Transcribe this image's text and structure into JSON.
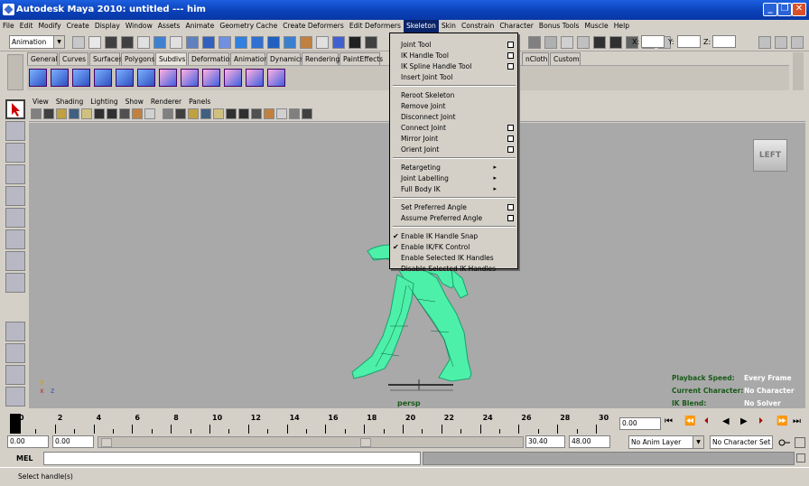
{
  "window": {
    "title": "Autodesk Maya 2010: untitled   ---   him"
  },
  "menubar": [
    "File",
    "Edit",
    "Modify",
    "Create",
    "Display",
    "Window",
    "Assets",
    "Animate",
    "Geometry Cache",
    "Create Deformers",
    "Edit Deformers",
    "Skeleton",
    "Skin",
    "Constrain",
    "Character",
    "Bonus Tools",
    "Muscle",
    "Help"
  ],
  "menubar_active": "Skeleton",
  "statusline": {
    "mode": "Animation",
    "x_label": "X:",
    "y_label": "Y:",
    "z_label": "Z:"
  },
  "shelf_tabs": [
    "General",
    "Curves",
    "Surfaces",
    "Polygons",
    "Subdivs",
    "Deformation",
    "Animation",
    "Dynamics",
    "Rendering",
    "PaintEffects",
    "nCloth",
    "Custom"
  ],
  "shelf_active": "Subdivs",
  "panel_menu": [
    "View",
    "Shading",
    "Lighting",
    "Show",
    "Renderer",
    "Panels"
  ],
  "viewport": {
    "camera_label": "persp",
    "view_cube_label": "LEFT",
    "axis_x": "x",
    "axis_z": "z",
    "axis_y": "y"
  },
  "hud": {
    "playback_label": "Playback Speed:",
    "playback_value": "Every Frame",
    "character_label": "Current Character:",
    "character_value": "No Character",
    "ikblend_label": "IK Blend:",
    "ikblend_value": "No Solver"
  },
  "skeleton_menu": {
    "group1": [
      {
        "label": "Joint Tool",
        "option": true
      },
      {
        "label": "IK Handle Tool",
        "option": true
      },
      {
        "label": "IK Spline Handle Tool",
        "option": true
      },
      {
        "label": "Insert Joint Tool",
        "option": false
      }
    ],
    "group2": [
      {
        "label": "Reroot Skeleton",
        "option": false
      },
      {
        "label": "Remove Joint",
        "option": false
      },
      {
        "label": "Disconnect Joint",
        "option": false
      },
      {
        "label": "Connect Joint",
        "option": true
      },
      {
        "label": "Mirror Joint",
        "option": true
      },
      {
        "label": "Orient Joint",
        "option": true
      }
    ],
    "group3": [
      {
        "label": "Retargeting",
        "submenu": true
      },
      {
        "label": "Joint Labelling",
        "submenu": true
      },
      {
        "label": "Full Body IK",
        "submenu": true
      }
    ],
    "group4": [
      {
        "label": "Set Preferred Angle",
        "option": true
      },
      {
        "label": "Assume Preferred Angle",
        "option": true
      }
    ],
    "group5": [
      {
        "label": "Enable IK Handle Snap",
        "checked": true
      },
      {
        "label": "Enable IK/FK Control",
        "checked": true
      },
      {
        "label": "Enable Selected IK Handles",
        "checked": false
      },
      {
        "label": "Disable Selected IK Handles",
        "checked": false
      }
    ]
  },
  "timeline": {
    "ticks": [
      "0",
      "2",
      "4",
      "6",
      "8",
      "10",
      "12",
      "14",
      "16",
      "18",
      "20",
      "22",
      "24",
      "26",
      "28",
      "30"
    ],
    "current_frame": "0.00",
    "start_time": "0.00",
    "start_range": "0.00",
    "end_range": "30.40",
    "end_time": "48.00",
    "anim_layer": "No Anim Layer",
    "character_set": "No Character Set"
  },
  "mel": {
    "label": "MEL"
  },
  "helpline": {
    "text": "Select handle(s)"
  },
  "colors": {
    "titlebar": "#0a3fb5",
    "viewport_bg": "#a9a9a9",
    "wireframe": "#3ef0a0",
    "menu_highlight": "#0a246a"
  }
}
